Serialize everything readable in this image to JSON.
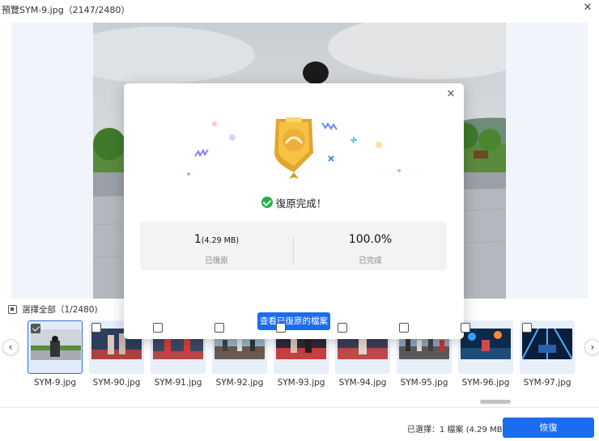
{
  "window": {
    "title": "預覽SYM-9.jpg（2147/2480）"
  },
  "selection": {
    "select_all_label": "選擇全部（1/2480)"
  },
  "thumbnails": [
    {
      "name": "SYM-9.jpg",
      "selected": true
    },
    {
      "name": "SYM-90.jpg",
      "selected": false
    },
    {
      "name": "SYM-91.jpg",
      "selected": false
    },
    {
      "name": "SYM-92.jpg",
      "selected": false
    },
    {
      "name": "SYM-93.jpg",
      "selected": false
    },
    {
      "name": "SYM-94.jpg",
      "selected": false
    },
    {
      "name": "SYM-95.jpg",
      "selected": false
    },
    {
      "name": "SYM-96.jpg",
      "selected": false
    },
    {
      "name": "SYM-97.jpg",
      "selected": false
    }
  ],
  "footer": {
    "status": "已選擇：1 檔案 (4.29 MB)",
    "recover_label": "恢復"
  },
  "dialog": {
    "done_text": "復原完成！",
    "recovered_count": "1",
    "recovered_size": "(4.29 MB)",
    "recovered_label": "已復原",
    "percent": "100.0%",
    "percent_label": "已完成",
    "view_button": "查看已復原的檔案"
  },
  "colors": {
    "accent": "#1a6cf0",
    "success": "#1fb34a",
    "selected_border": "#2e6fe0"
  },
  "icons": {
    "window_close": "close-icon",
    "dialog_close": "close-icon",
    "nav_left": "chevron-left-icon",
    "nav_right": "chevron-right-icon",
    "badge": "gold-trophy-badge-icon",
    "done": "check-circle-icon"
  }
}
